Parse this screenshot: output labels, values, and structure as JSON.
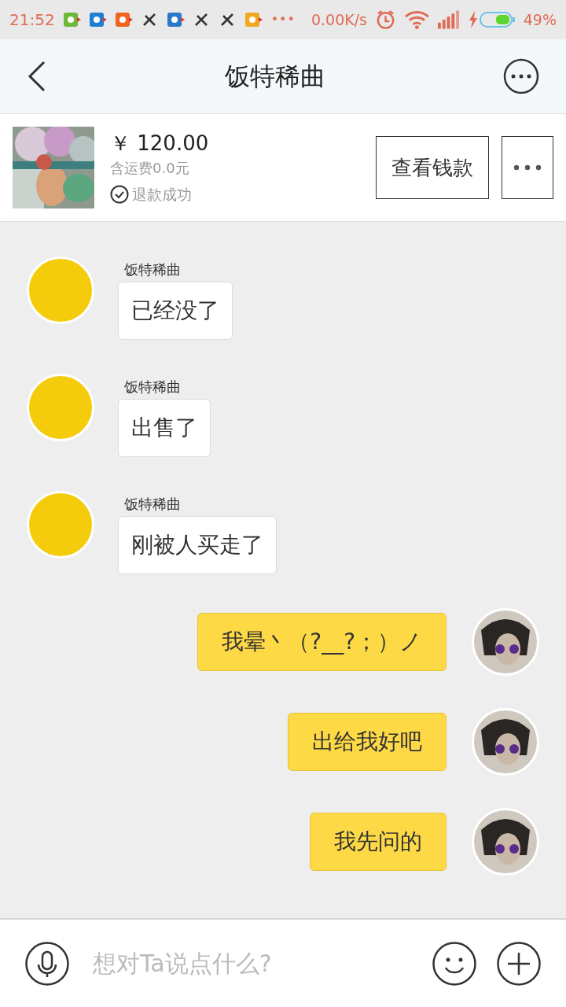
{
  "status_bar": {
    "time": "21:52",
    "overflow": "•••",
    "net_speed": "0.00K/s",
    "battery": "49%"
  },
  "header": {
    "title": "饭特稀曲"
  },
  "product": {
    "price": "￥ 120.00",
    "shipping": "含运费0.0元",
    "status": "退款成功",
    "button": "查看钱款"
  },
  "messages": [
    {
      "kind": "incoming",
      "sender": "饭特稀曲",
      "text": "已经没了"
    },
    {
      "kind": "incoming",
      "sender": "饭特稀曲",
      "text": "出售了"
    },
    {
      "kind": "incoming",
      "sender": "饭特稀曲",
      "text": "刚被人买走了"
    },
    {
      "kind": "outgoing",
      "text": "我晕丶（?__?；）ノ"
    },
    {
      "kind": "outgoing",
      "text": "出给我好吧"
    },
    {
      "kind": "outgoing",
      "text": "我先问的"
    }
  ],
  "input": {
    "placeholder": "想对Ta说点什么?"
  }
}
